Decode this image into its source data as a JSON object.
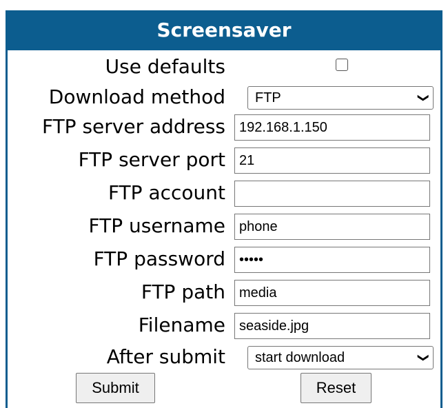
{
  "header": {
    "title": "Screensaver"
  },
  "form": {
    "use_defaults_label": "Use defaults",
    "use_defaults_checked": false,
    "download_method_label": "Download method",
    "download_method_value": "FTP",
    "ftp_server_address_label": "FTP server address",
    "ftp_server_address_value": "192.168.1.150",
    "ftp_server_port_label": "FTP server port",
    "ftp_server_port_value": "21",
    "ftp_account_label": "FTP account",
    "ftp_account_value": "",
    "ftp_username_label": "FTP username",
    "ftp_username_value": "phone",
    "ftp_password_label": "FTP password",
    "ftp_password_value": "•••••",
    "ftp_path_label": "FTP path",
    "ftp_path_value": "media",
    "filename_label": "Filename",
    "filename_value": "seaside.jpg",
    "after_submit_label": "After submit",
    "after_submit_value": "start download"
  },
  "buttons": {
    "submit_label": "Submit",
    "reset_label": "Reset"
  },
  "colors": {
    "header_bg": "#0c5d8f",
    "header_text": "#ffffff"
  },
  "icons": {
    "dropdown": "chevron-down-icon"
  }
}
